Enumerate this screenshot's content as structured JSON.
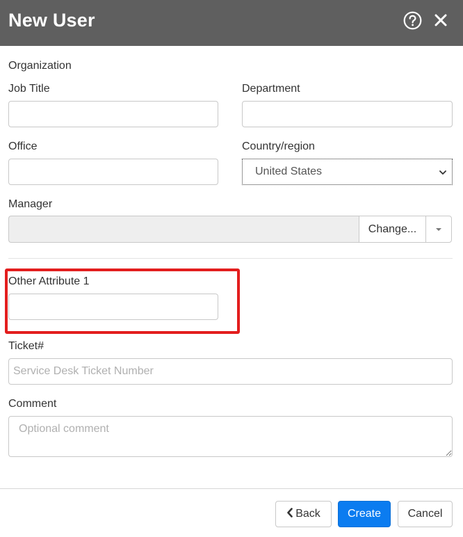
{
  "dialog": {
    "title": "New User",
    "help_icon": "question-circle-icon",
    "close_icon": "close-icon"
  },
  "organization": {
    "section_label": "Organization",
    "job_title": {
      "label": "Job Title",
      "value": ""
    },
    "department": {
      "label": "Department",
      "value": ""
    },
    "office": {
      "label": "Office",
      "value": ""
    },
    "country": {
      "label": "Country/region",
      "selected": "United States"
    },
    "manager": {
      "label": "Manager",
      "value": "",
      "change_label": "Change..."
    }
  },
  "other_attribute_1": {
    "label": "Other Attribute 1",
    "value": ""
  },
  "ticket": {
    "label": "Ticket#",
    "placeholder": "Service Desk Ticket Number",
    "value": ""
  },
  "comment": {
    "label": "Comment",
    "placeholder": "Optional comment",
    "value": ""
  },
  "footer": {
    "back_label": "Back",
    "create_label": "Create",
    "cancel_label": "Cancel"
  },
  "colors": {
    "header_bg": "#5f5f5f",
    "primary": "#0b7cf0",
    "highlight": "#e31e1e"
  }
}
